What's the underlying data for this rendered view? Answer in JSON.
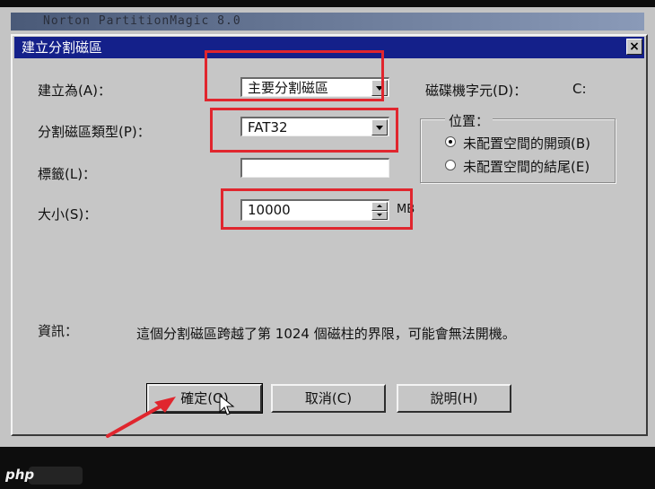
{
  "background_window": {
    "title": "Norton PartitionMagic 8.0"
  },
  "dialog": {
    "title": "建立分割磁區",
    "close_label": "×"
  },
  "fields": {
    "create_as": {
      "label": "建立為(A)：",
      "value": "主要分割磁區"
    },
    "partition_type": {
      "label": "分割磁區類型(P)：",
      "value": "FAT32"
    },
    "label": {
      "label": "標籤(L)：",
      "value": ""
    },
    "size": {
      "label": "大小(S)：",
      "value": "10000",
      "unit": "MB"
    }
  },
  "drive_letter": {
    "label": "磁碟機字元(D)：",
    "value": "C:"
  },
  "position_group": {
    "title": "位置：",
    "options": [
      {
        "label": "未配置空間的開頭(B)",
        "selected": true
      },
      {
        "label": "未配置空間的結尾(E)",
        "selected": false
      }
    ]
  },
  "info": {
    "label": "資訊：",
    "text": "這個分割磁區跨越了第 1024 個磁柱的界限，可能會無法開機。"
  },
  "buttons": {
    "ok": "確定(O)",
    "cancel": "取消(C)",
    "help": "說明(H)"
  },
  "watermark": "php",
  "colors": {
    "titlebar": "#14208a",
    "dialog_face": "#c6c6c6",
    "highlight_red": "#e0262e"
  }
}
